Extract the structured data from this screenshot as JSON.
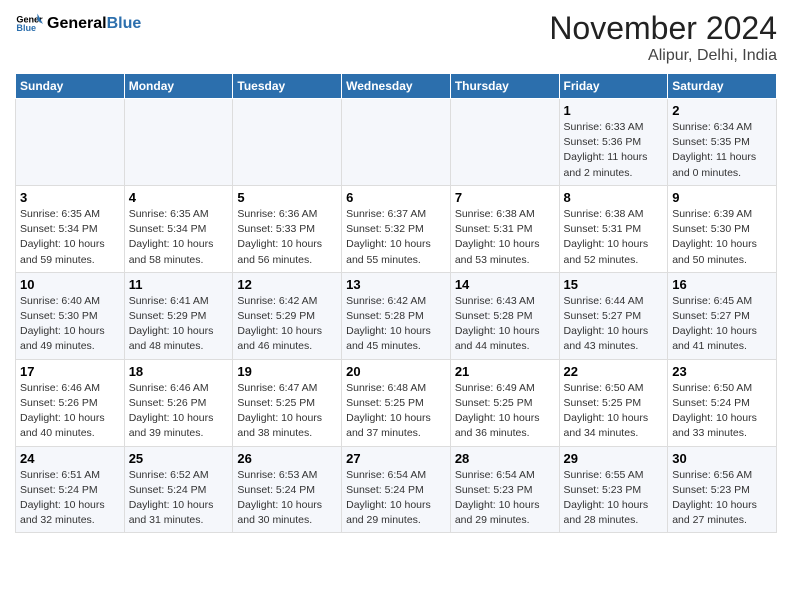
{
  "header": {
    "logo_line1": "General",
    "logo_line2": "Blue",
    "month": "November 2024",
    "location": "Alipur, Delhi, India"
  },
  "weekdays": [
    "Sunday",
    "Monday",
    "Tuesday",
    "Wednesday",
    "Thursday",
    "Friday",
    "Saturday"
  ],
  "weeks": [
    [
      {
        "day": "",
        "info": ""
      },
      {
        "day": "",
        "info": ""
      },
      {
        "day": "",
        "info": ""
      },
      {
        "day": "",
        "info": ""
      },
      {
        "day": "",
        "info": ""
      },
      {
        "day": "1",
        "info": "Sunrise: 6:33 AM\nSunset: 5:36 PM\nDaylight: 11 hours and 2 minutes."
      },
      {
        "day": "2",
        "info": "Sunrise: 6:34 AM\nSunset: 5:35 PM\nDaylight: 11 hours and 0 minutes."
      }
    ],
    [
      {
        "day": "3",
        "info": "Sunrise: 6:35 AM\nSunset: 5:34 PM\nDaylight: 10 hours and 59 minutes."
      },
      {
        "day": "4",
        "info": "Sunrise: 6:35 AM\nSunset: 5:34 PM\nDaylight: 10 hours and 58 minutes."
      },
      {
        "day": "5",
        "info": "Sunrise: 6:36 AM\nSunset: 5:33 PM\nDaylight: 10 hours and 56 minutes."
      },
      {
        "day": "6",
        "info": "Sunrise: 6:37 AM\nSunset: 5:32 PM\nDaylight: 10 hours and 55 minutes."
      },
      {
        "day": "7",
        "info": "Sunrise: 6:38 AM\nSunset: 5:31 PM\nDaylight: 10 hours and 53 minutes."
      },
      {
        "day": "8",
        "info": "Sunrise: 6:38 AM\nSunset: 5:31 PM\nDaylight: 10 hours and 52 minutes."
      },
      {
        "day": "9",
        "info": "Sunrise: 6:39 AM\nSunset: 5:30 PM\nDaylight: 10 hours and 50 minutes."
      }
    ],
    [
      {
        "day": "10",
        "info": "Sunrise: 6:40 AM\nSunset: 5:30 PM\nDaylight: 10 hours and 49 minutes."
      },
      {
        "day": "11",
        "info": "Sunrise: 6:41 AM\nSunset: 5:29 PM\nDaylight: 10 hours and 48 minutes."
      },
      {
        "day": "12",
        "info": "Sunrise: 6:42 AM\nSunset: 5:29 PM\nDaylight: 10 hours and 46 minutes."
      },
      {
        "day": "13",
        "info": "Sunrise: 6:42 AM\nSunset: 5:28 PM\nDaylight: 10 hours and 45 minutes."
      },
      {
        "day": "14",
        "info": "Sunrise: 6:43 AM\nSunset: 5:28 PM\nDaylight: 10 hours and 44 minutes."
      },
      {
        "day": "15",
        "info": "Sunrise: 6:44 AM\nSunset: 5:27 PM\nDaylight: 10 hours and 43 minutes."
      },
      {
        "day": "16",
        "info": "Sunrise: 6:45 AM\nSunset: 5:27 PM\nDaylight: 10 hours and 41 minutes."
      }
    ],
    [
      {
        "day": "17",
        "info": "Sunrise: 6:46 AM\nSunset: 5:26 PM\nDaylight: 10 hours and 40 minutes."
      },
      {
        "day": "18",
        "info": "Sunrise: 6:46 AM\nSunset: 5:26 PM\nDaylight: 10 hours and 39 minutes."
      },
      {
        "day": "19",
        "info": "Sunrise: 6:47 AM\nSunset: 5:25 PM\nDaylight: 10 hours and 38 minutes."
      },
      {
        "day": "20",
        "info": "Sunrise: 6:48 AM\nSunset: 5:25 PM\nDaylight: 10 hours and 37 minutes."
      },
      {
        "day": "21",
        "info": "Sunrise: 6:49 AM\nSunset: 5:25 PM\nDaylight: 10 hours and 36 minutes."
      },
      {
        "day": "22",
        "info": "Sunrise: 6:50 AM\nSunset: 5:25 PM\nDaylight: 10 hours and 34 minutes."
      },
      {
        "day": "23",
        "info": "Sunrise: 6:50 AM\nSunset: 5:24 PM\nDaylight: 10 hours and 33 minutes."
      }
    ],
    [
      {
        "day": "24",
        "info": "Sunrise: 6:51 AM\nSunset: 5:24 PM\nDaylight: 10 hours and 32 minutes."
      },
      {
        "day": "25",
        "info": "Sunrise: 6:52 AM\nSunset: 5:24 PM\nDaylight: 10 hours and 31 minutes."
      },
      {
        "day": "26",
        "info": "Sunrise: 6:53 AM\nSunset: 5:24 PM\nDaylight: 10 hours and 30 minutes."
      },
      {
        "day": "27",
        "info": "Sunrise: 6:54 AM\nSunset: 5:24 PM\nDaylight: 10 hours and 29 minutes."
      },
      {
        "day": "28",
        "info": "Sunrise: 6:54 AM\nSunset: 5:23 PM\nDaylight: 10 hours and 29 minutes."
      },
      {
        "day": "29",
        "info": "Sunrise: 6:55 AM\nSunset: 5:23 PM\nDaylight: 10 hours and 28 minutes."
      },
      {
        "day": "30",
        "info": "Sunrise: 6:56 AM\nSunset: 5:23 PM\nDaylight: 10 hours and 27 minutes."
      }
    ]
  ]
}
